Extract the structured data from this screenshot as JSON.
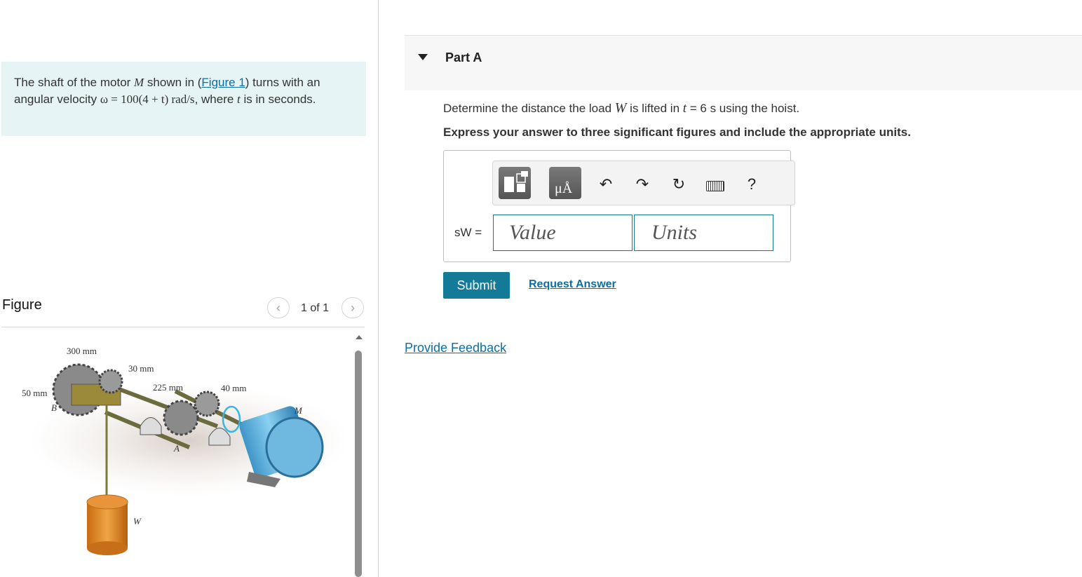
{
  "problem": {
    "text_1": "The shaft of the motor ",
    "motor_symbol": "M",
    "text_2": " shown in (",
    "figure_link": "Figure 1",
    "text_3": ") turns with an angular velocity ",
    "omega_expr": "ω = 100(4 + t) rad/s",
    "text_4": ", where ",
    "t_symbol": "t",
    "text_5": " is in seconds."
  },
  "figure": {
    "title": "Figure",
    "pager": "1 of 1",
    "prev_icon": "chevron-left-icon",
    "next_icon": "chevron-right-icon",
    "labels": {
      "d300": "300 mm",
      "d30": "30 mm",
      "d225": "225 mm",
      "d40": "40 mm",
      "d50": "50 mm",
      "B": "B",
      "A": "A",
      "M": "M",
      "W": "W"
    }
  },
  "part": {
    "title": "Part A",
    "question_1": "Determine the distance the load ",
    "question_W": "W",
    "question_2": " is lifted in ",
    "question_t": "t",
    "question_3": " = 6 s using the hoist.",
    "instruction": "Express your answer to three significant figures and include the appropriate units."
  },
  "answer": {
    "label": "sW =",
    "value_placeholder": "Value",
    "units_placeholder": "Units",
    "units_button": "μÅ",
    "help": "?"
  },
  "actions": {
    "submit": "Submit",
    "request_answer": "Request Answer",
    "provide_feedback": "Provide Feedback"
  },
  "colors": {
    "accent": "#137a98",
    "link": "#0b6ea5",
    "problem_bg": "#e6f4f6"
  }
}
